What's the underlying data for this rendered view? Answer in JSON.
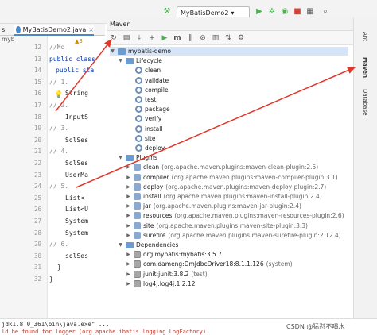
{
  "toolbar": {
    "run_config": "MyBatisDemo2"
  },
  "editor": {
    "tab_label": "MyBatisDemo2.java",
    "gutter_left": "myb",
    "line_numbers": [
      "12",
      "13",
      "14",
      "15",
      "16",
      "17",
      "18",
      "19",
      "20",
      "21",
      "22",
      "23",
      "24",
      "25",
      "26",
      "27",
      "28",
      "29",
      "30",
      "31",
      "32"
    ],
    "code_lines": [
      "//Mo",
      "public class",
      "public sta",
      "//        1.",
      "String",
      "//        2.",
      "InputS",
      "//        3.",
      "SqlSes",
      "//        4.",
      "SqlSes",
      "UserMa",
      "//        5.",
      "List<",
      "List<U",
      "System",
      "System",
      "//        6.",
      "sqlSes",
      "}",
      "}"
    ],
    "warnings": "▲3"
  },
  "maven": {
    "title": "Maven",
    "project": "mybatis-demo",
    "lifecycle_label": "Lifecycle",
    "lifecycle": [
      "clean",
      "validate",
      "compile",
      "test",
      "package",
      "verify",
      "install",
      "site",
      "deploy"
    ],
    "plugins_label": "Plugins",
    "plugins": [
      {
        "name": "clean",
        "detail": "(org.apache.maven.plugins:maven-clean-plugin:2.5)"
      },
      {
        "name": "compiler",
        "detail": "(org.apache.maven.plugins:maven-compiler-plugin:3.1)"
      },
      {
        "name": "deploy",
        "detail": "(org.apache.maven.plugins:maven-deploy-plugin:2.7)"
      },
      {
        "name": "install",
        "detail": "(org.apache.maven.plugins:maven-install-plugin:2.4)"
      },
      {
        "name": "jar",
        "detail": "(org.apache.maven.plugins:maven-jar-plugin:2.4)"
      },
      {
        "name": "resources",
        "detail": "(org.apache.maven.plugins:maven-resources-plugin:2.6)"
      },
      {
        "name": "site",
        "detail": "(org.apache.maven.plugins:maven-site-plugin:3.3)"
      },
      {
        "name": "surefire",
        "detail": "(org.apache.maven.plugins:maven-surefire-plugin:2.12.4)"
      }
    ],
    "dependencies_label": "Dependencies",
    "dependencies": [
      {
        "name": "org.mybatis:mybatis:3.5.7",
        "detail": ""
      },
      {
        "name": "com.dameng:DmJdbcDriver18:8.1.1.126",
        "detail": "(system)"
      },
      {
        "name": "junit:junit:3.8.2",
        "detail": "(test)"
      },
      {
        "name": "log4j:log4j:1.2.12",
        "detail": ""
      }
    ]
  },
  "side_tabs": {
    "ant": "Ant",
    "maven": "Maven",
    "database": "Database"
  },
  "bottom": {
    "line1": "jdk1.8.0_361\\bin\\java.exe\" ...",
    "line2": "ld be found for logger (org.apache.ibatis.logging.LogFactory)",
    "watermark": "CSDN @猛怼不喝水"
  },
  "colors": {
    "arrow": "#e0382b",
    "accent": "#4a88c7"
  }
}
